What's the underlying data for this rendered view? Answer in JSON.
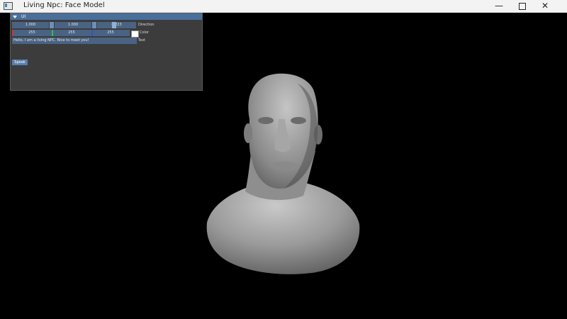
{
  "window": {
    "title": "Living Npc: Face Model",
    "min": "—",
    "close": "✕"
  },
  "panel": {
    "title": "UI",
    "direction": {
      "values": [
        "1.000",
        "1.000",
        "0.223"
      ],
      "label": "Direction"
    },
    "color": {
      "values": [
        "255",
        "255",
        "255"
      ],
      "label": "Color",
      "channel_colors": [
        "#c23a3a",
        "#31c23a",
        "#3a4fc2"
      ],
      "preview": "#ffffff"
    },
    "text": {
      "value": "Hello, I am a living NPC. Nice to meet you!",
      "label": "Text"
    },
    "speak_button": "Speak"
  }
}
